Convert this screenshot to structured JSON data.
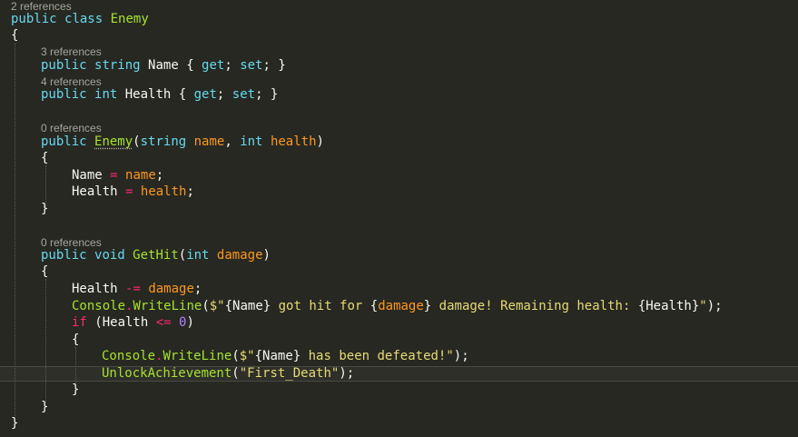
{
  "code_lens": {
    "class_refs": "2 references",
    "name_refs": "3 references",
    "health_refs": "4 references",
    "ctor_refs": "0 references",
    "gethit_refs": "0 references"
  },
  "tokens": {
    "public": "public",
    "class": "class",
    "string": "string",
    "int": "int",
    "void": "void",
    "if": "if",
    "get": "get",
    "set": "set",
    "Enemy": "Enemy",
    "Name": "Name",
    "Health": "Health",
    "GetHit": "GetHit",
    "name": "name",
    "health": "health",
    "damage": "damage",
    "Console": "Console",
    "WriteLine": "WriteLine",
    "UnlockAchievement": "UnlockAchievement",
    "zero": "0",
    "str_hit_1": "$\"",
    "str_hit_2": " got hit for ",
    "str_hit_3": " damage! Remaining health: ",
    "str_hit_4": "\"",
    "str_def_1": "$\"",
    "str_def_2": " has been defeated!\"",
    "str_first_death": "\"First_Death\""
  },
  "theme": {
    "background": "#272822",
    "keyword": "#66d9ef",
    "type_name": "#a6e22e",
    "parameter": "#fd971f",
    "operator": "#f92672",
    "number": "#ae81ff",
    "string": "#e6db74",
    "text": "#f8f8f2"
  }
}
